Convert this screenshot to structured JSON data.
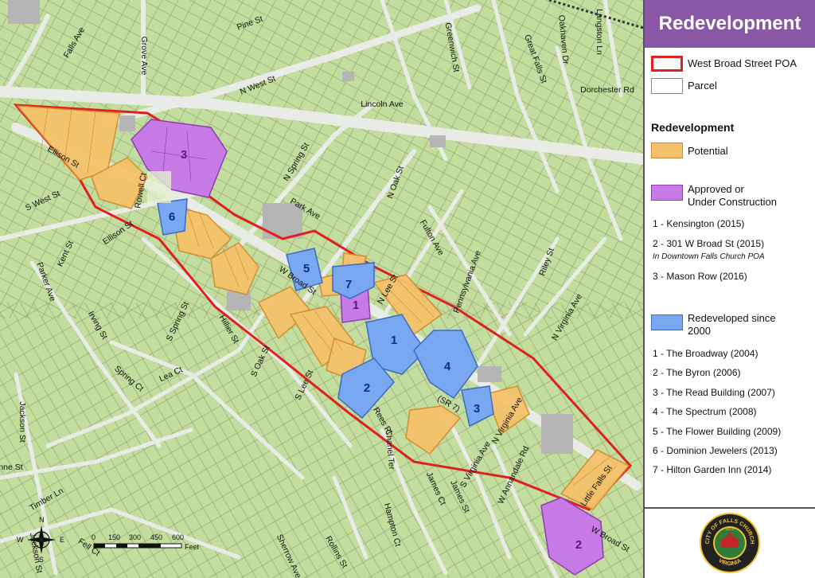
{
  "legend": {
    "title": "Redevelopment",
    "boundary_items": [
      {
        "label": "West Broad Street POA",
        "color": "#e02020"
      },
      {
        "label": "Parcel",
        "color": "#888888"
      }
    ],
    "section_heading": "Redevelopment",
    "potential": {
      "label": "Potential",
      "color": "#f5c26b"
    },
    "approved": {
      "label_line1": "Approved or",
      "label_line2": "Under Construction",
      "color": "#c87ae6",
      "items": [
        "1 - Kensington (2015)",
        "2 - 301 W Broad St (2015)",
        "3 - Mason Row (2016)"
      ],
      "note": "In Downtown Falls Church POA"
    },
    "redeveloped": {
      "label_line1": "Redeveloped since",
      "label_line2": "2000",
      "color": "#7aa8f0",
      "items": [
        "1 - The Broadway (2004)",
        "2 - The Byron (2006)",
        "3 - The Read Building (2007)",
        "4 - The Spectrum (2008)",
        "5 - The Flower Building (2009)",
        "6 - Dominion Jewelers (2013)",
        "7 - Hilton Garden Inn (2014)"
      ]
    },
    "seal": {
      "top_text": "CITY OF FALLS CHURCH",
      "bottom_text": "VIRGINIA",
      "year": "1875"
    }
  },
  "map": {
    "street_labels": [
      {
        "text": "Falls Ave",
        "angle": -60
      },
      {
        "text": "Grove Ave",
        "angle": 90
      },
      {
        "text": "Pine St",
        "angle": -20
      },
      {
        "text": "N West St",
        "angle": -22
      },
      {
        "text": "Greenwich St",
        "angle": 80
      },
      {
        "text": "Great Falls St",
        "angle": 70
      },
      {
        "text": "Oakhaven Dr",
        "angle": 85
      },
      {
        "text": "Langston Ln",
        "angle": 90
      },
      {
        "text": "Lincoln Ave",
        "angle": 0
      },
      {
        "text": "Dorchester Rd",
        "angle": 0
      },
      {
        "text": "Ellison St",
        "angle": 30
      },
      {
        "text": "Rowell Ct",
        "angle": -80
      },
      {
        "text": "S West St",
        "angle": -25
      },
      {
        "text": "N Spring St",
        "angle": -60
      },
      {
        "text": "N Oak St",
        "angle": -70
      },
      {
        "text": "Fulton Ave",
        "angle": 60
      },
      {
        "text": "Park Ave",
        "angle": 30
      },
      {
        "text": "Kent St",
        "angle": -65
      },
      {
        "text": "Ellison St",
        "angle": -35
      },
      {
        "text": "Parker Ave",
        "angle": 70
      },
      {
        "text": "Pennsylvania Ave",
        "angle": -70
      },
      {
        "text": "Riley St",
        "angle": -70
      },
      {
        "text": "N Virginia Ave",
        "angle": -60
      },
      {
        "text": "W Broad St",
        "angle": 35
      },
      {
        "text": "N Lee St",
        "angle": -60
      },
      {
        "text": "Irving St",
        "angle": 60
      },
      {
        "text": "S Spring St",
        "angle": -65
      },
      {
        "text": "Hillier St",
        "angle": 60
      },
      {
        "text": "S Oak St",
        "angle": -65
      },
      {
        "text": "Lea Ct",
        "angle": -25
      },
      {
        "text": "Spring Ct",
        "angle": 40
      },
      {
        "text": "S Lee St",
        "angle": -65
      },
      {
        "text": "(SR 7)",
        "angle": 30
      },
      {
        "text": "Rees Pl",
        "angle": 60
      },
      {
        "text": "Chanel Ter",
        "angle": 85
      },
      {
        "text": "N Virginia Ave",
        "angle": -60
      },
      {
        "text": "S Virginia Ave",
        "angle": -60
      },
      {
        "text": "Little Falls St",
        "angle": -55
      },
      {
        "text": "W Annandale Rd",
        "angle": -65
      },
      {
        "text": "James Ct",
        "angle": 65
      },
      {
        "text": "James St",
        "angle": 65
      },
      {
        "text": "Hampton Ct",
        "angle": 75
      },
      {
        "text": "Jackson St",
        "angle": 90
      },
      {
        "text": "Anne St",
        "angle": 0
      },
      {
        "text": "Timber Ln",
        "angle": -30
      },
      {
        "text": "Jackson St",
        "angle": 80
      },
      {
        "text": "Rollins St",
        "angle": 60
      },
      {
        "text": "Sherrow Ave",
        "angle": 65
      },
      {
        "text": "W Broad St",
        "angle": 30
      },
      {
        "text": "Fell Ct",
        "angle": 35
      }
    ],
    "approved_labels": [
      "1",
      "2",
      "3"
    ],
    "redeveloped_labels": [
      "1",
      "2",
      "3",
      "4",
      "5",
      "6",
      "7"
    ],
    "compass": {
      "n": "N",
      "s": "S",
      "e": "E",
      "w": "W"
    },
    "scale_bar": {
      "ticks": [
        "0",
        "150",
        "300",
        "450",
        "600"
      ],
      "unit": "Feet"
    }
  }
}
